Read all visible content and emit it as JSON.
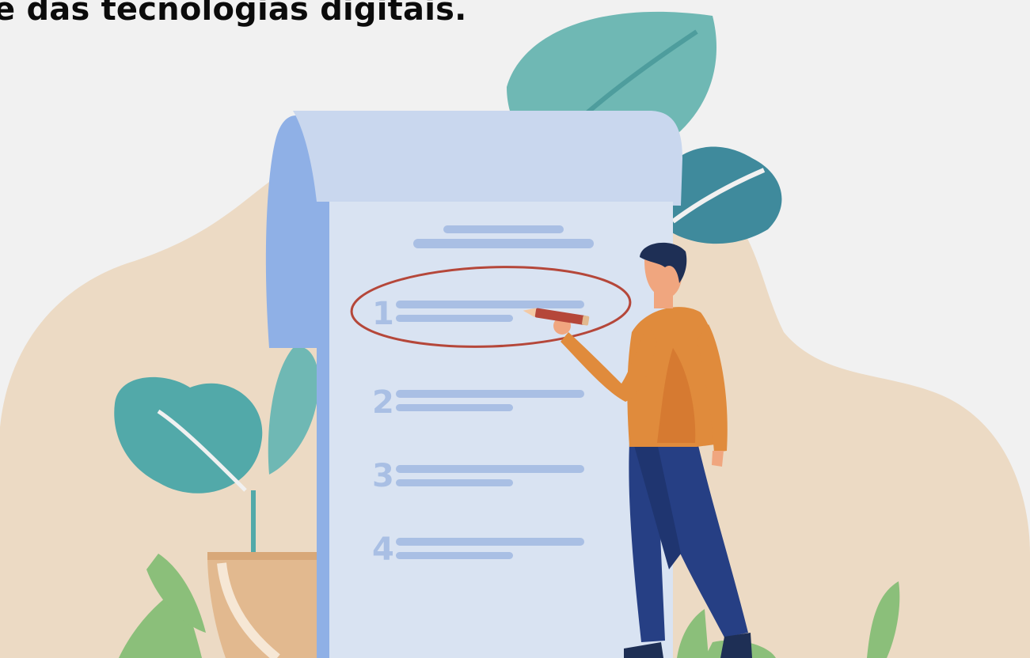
{
  "headline": "e das tecnologias digitais.",
  "list_numbers": [
    "1",
    "2",
    "3",
    "4"
  ],
  "colors": {
    "background": "#f1f1f1",
    "blob": "#ecdac4",
    "paper": "#d9e3f2",
    "scroll_roll": "#8fb0e6",
    "list_line": "#a9bfe4",
    "highlight_ring": "#b5473a",
    "leaf_teal": "#52a9a9",
    "leaf_dark_teal": "#3f8a9c",
    "leaf_green": "#8bbf7a",
    "shirt": "#e08b3c",
    "trousers": "#263f84",
    "hair": "#1e2f55",
    "skin": "#f0a67f",
    "pencil": "#b5473a",
    "pot": "#e2b98f"
  },
  "icons": [
    "checklist-scroll-icon",
    "pencil-icon",
    "plant-icon",
    "person-icon"
  ]
}
